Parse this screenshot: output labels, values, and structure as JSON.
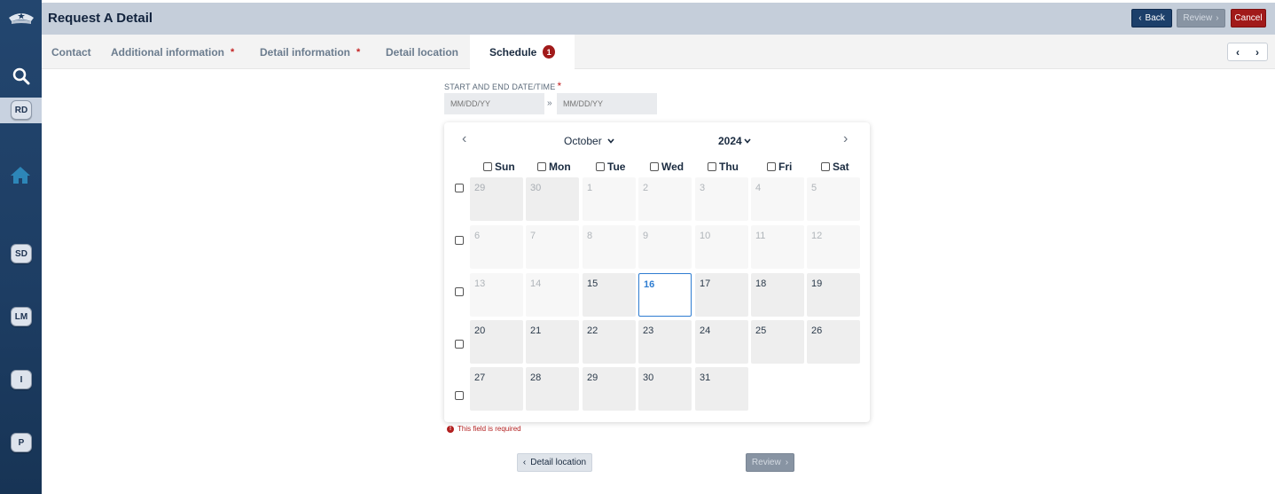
{
  "sidebar": {
    "logo_icon": "police-cap-icon",
    "search_icon": "search-icon",
    "home_icon": "home-icon",
    "badges": [
      "RD",
      "SD",
      "LM",
      "I",
      "P"
    ]
  },
  "header": {
    "title": "Request A Detail",
    "back_label": "Back",
    "review_label": "Review",
    "cancel_label": "Cancel"
  },
  "tabs": [
    {
      "label": "Contact",
      "required": ""
    },
    {
      "label": "Additional information",
      "required": "*"
    },
    {
      "label": "Detail information",
      "required": "*"
    },
    {
      "label": "Detail location",
      "required": ""
    },
    {
      "label": "Schedule",
      "badge": "1",
      "active": true
    }
  ],
  "form": {
    "label": "START AND END DATE/TIME",
    "required_mark": "*",
    "start_placeholder": "MM/DD/YY",
    "end_placeholder": "MM/DD/YY",
    "range_separator": "»",
    "error": "This field is required",
    "error_icon": "!"
  },
  "calendar": {
    "month": "October",
    "year": "2024",
    "weekdays": [
      "Sun",
      "Mon",
      "Tue",
      "Wed",
      "Thu",
      "Fri",
      "Sat"
    ],
    "weeks": [
      [
        "29",
        "30",
        "1",
        "2",
        "3",
        "4",
        "5"
      ],
      [
        "6",
        "7",
        "8",
        "9",
        "10",
        "11",
        "12"
      ],
      [
        "13",
        "14",
        "15",
        "16",
        "17",
        "18",
        "19"
      ],
      [
        "20",
        "21",
        "22",
        "23",
        "24",
        "25",
        "26"
      ],
      [
        "27",
        "28",
        "29",
        "30",
        "31",
        "",
        ""
      ]
    ],
    "today": "16"
  },
  "footer": {
    "prev_label": "Detail location",
    "next_label": "Review"
  }
}
